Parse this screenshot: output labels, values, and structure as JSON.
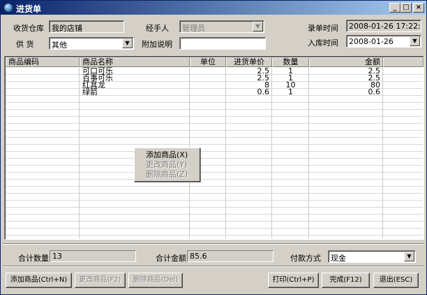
{
  "window": {
    "title": "进货单"
  },
  "form": {
    "warehouse_label": "收货仓库",
    "warehouse_value": "我的店铺",
    "handler_label": "经手人",
    "handler_value": "管理员",
    "entry_time_label": "录单时间",
    "entry_time_value": "2008-01-26 17:22:35",
    "supplier_label": "供    货",
    "supplier_value": "其他",
    "note_label": "附加说明",
    "note_value": "",
    "stock_time_label": "入库时间",
    "stock_time_value": "2008-01-26"
  },
  "grid": {
    "headers": [
      "商品编码",
      "商品名称",
      "单位",
      "进货单价",
      "数量",
      "金额"
    ],
    "rows": [
      {
        "code": "",
        "name": "可口可乐",
        "unit": "",
        "price": "2.5",
        "qty": "1",
        "amount": "2.5"
      },
      {
        "code": "",
        "name": "百事可乐",
        "unit": "",
        "price": "2.5",
        "qty": "1",
        "amount": "2.5"
      },
      {
        "code": "",
        "name": "红其龙",
        "unit": "",
        "price": "8",
        "qty": "10",
        "amount": "80"
      },
      {
        "code": "",
        "name": "绿箭",
        "unit": "",
        "price": "0.6",
        "qty": "1",
        "amount": "0.6"
      }
    ]
  },
  "context_menu": {
    "items": [
      {
        "label": "添加商品(X)",
        "enabled": true
      },
      {
        "label": "更改商品(Y)",
        "enabled": false
      },
      {
        "label": "删除商品(Z)",
        "enabled": false
      }
    ]
  },
  "summary": {
    "total_qty_label": "合计数量",
    "total_qty_value": "13",
    "total_amount_label": "合计金额",
    "total_amount_value": "85.6",
    "payment_label": "付款方式",
    "payment_value": "现金"
  },
  "buttons": {
    "add": "添加商品(Ctrl+N)",
    "edit": "更改商品(F2)",
    "delete": "删除商品(Del)",
    "print": "打印(Ctrl+P)",
    "finish": "完成(F12)",
    "exit": "退出(ESC)"
  }
}
